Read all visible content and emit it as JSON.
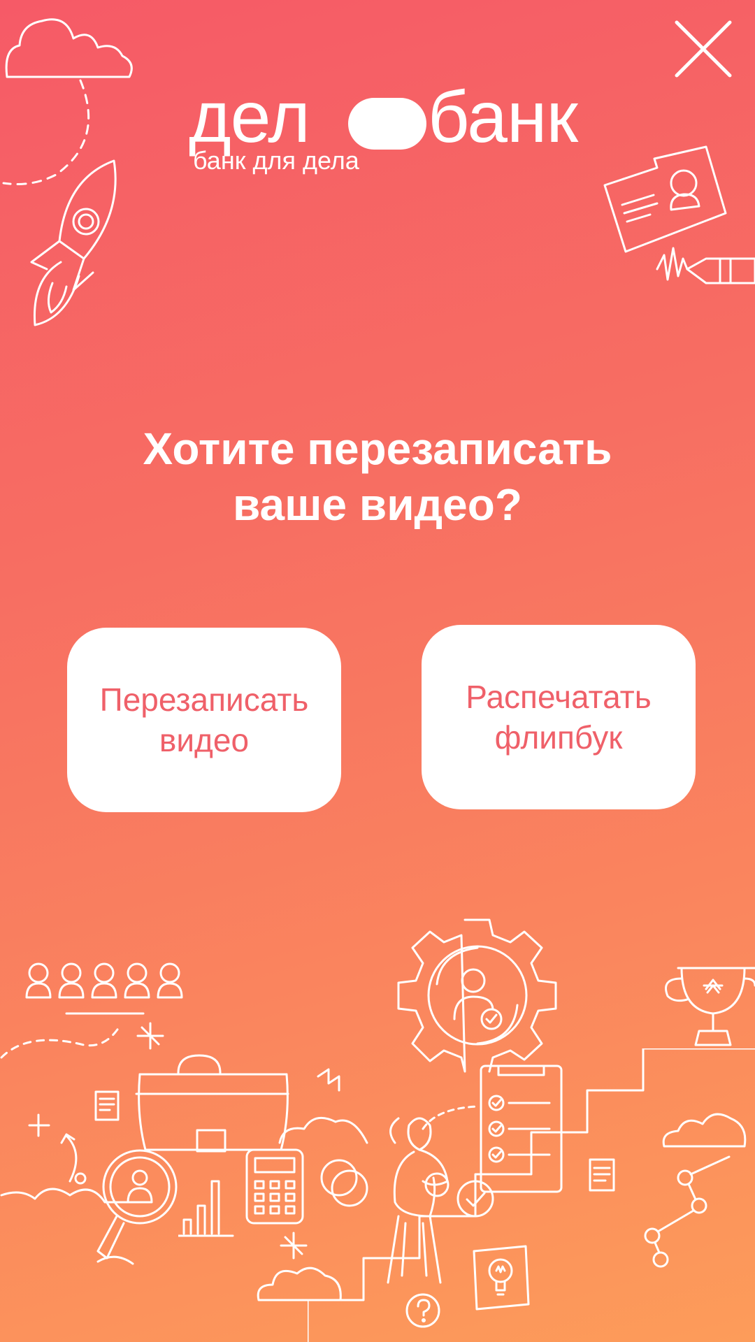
{
  "brand": {
    "name_left": "дел",
    "name_right": "банк",
    "tagline": "банк для дела"
  },
  "dialog": {
    "question_line1": "Хотите перезаписать",
    "question_line2": "ваше видео?"
  },
  "buttons": {
    "rerecord_line1": "Перезаписать",
    "rerecord_line2": "видео",
    "print_line1": "Распечатать",
    "print_line2": "флипбук"
  },
  "icons": {
    "close": "close-icon",
    "cloud": "cloud-icon",
    "rocket": "rocket-icon",
    "id_card": "id-card-icon",
    "marker": "marker-icon",
    "people": "people-icon",
    "briefcase": "briefcase-icon",
    "magnifier": "magnifier-person-icon",
    "calculator": "calculator-icon",
    "gear": "gear-person-icon",
    "checklist": "checklist-icon",
    "trophy": "trophy-icon",
    "lightbulb": "lightbulb-icon",
    "question": "question-icon"
  },
  "colors": {
    "gradient_top": "#f65a67",
    "gradient_bottom": "#fd9c5a",
    "button_bg": "#ffffff",
    "button_text": "#ef6069"
  }
}
